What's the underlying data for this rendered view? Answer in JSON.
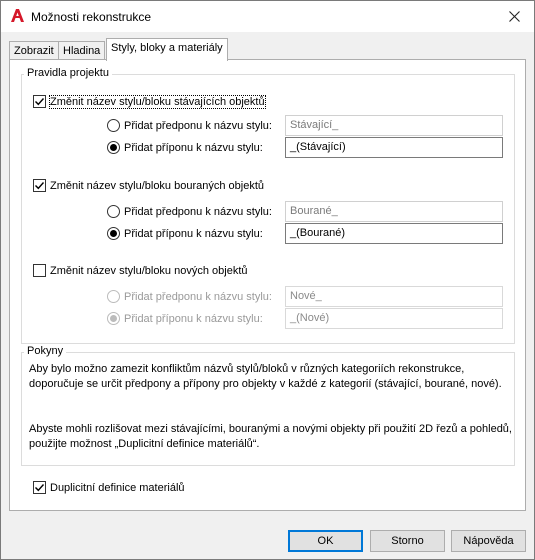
{
  "window": {
    "title": "Možnosti rekonstrukce",
    "icon": "autocad-a-icon",
    "accent_color": "#d5182a"
  },
  "tabs": [
    {
      "label": "Zobrazit",
      "active": false
    },
    {
      "label": "Hladina",
      "active": false
    },
    {
      "label": "Styly, bloky a materiály",
      "active": true
    }
  ],
  "project_rules": {
    "title": "Pravidla projektu",
    "existing": {
      "checkbox_label": "Změnit název stylu/bloku stávajících objektů",
      "checked": true,
      "prefix_label": "Přidat předponu k názvu stylu:",
      "prefix_value": "Stávající_",
      "suffix_label": "Přidat příponu k názvu stylu:",
      "suffix_value": "_(Stávající)",
      "selected": "suffix"
    },
    "demolished": {
      "checkbox_label": "Změnit název stylu/bloku bouraných objektů",
      "checked": true,
      "prefix_label": "Přidat předponu k názvu stylu:",
      "prefix_value": "Bourané_",
      "suffix_label": "Přidat příponu k názvu stylu:",
      "suffix_value": "_(Bourané)",
      "selected": "suffix"
    },
    "new": {
      "checkbox_label": "Změnit název stylu/bloku nových objektů",
      "checked": false,
      "prefix_label": "Přidat předponu k názvu stylu:",
      "prefix_value": "Nové_",
      "suffix_label": "Přidat příponu k názvu stylu:",
      "suffix_value": "_(Nové)",
      "selected": "suffix"
    }
  },
  "notes": {
    "title": "Pokyny",
    "paragraph1_line1": "Aby bylo možno zamezit konfliktům názvů stylů/bloků v různých kategoriích rekonstrukce,",
    "paragraph1_line2": "doporučuje se určit předpony a přípony pro objekty v každé z kategorií (stávající, bourané, nové).",
    "paragraph2_line1": "Abyste mohli rozlišovat mezi stávajícími, bouranými a novými objekty při použití 2D řezů a pohledů,",
    "paragraph2_line2": "použijte možnost „Duplicitní definice materiálů“."
  },
  "duplicate_materials": {
    "label": "Duplicitní definice materiálů",
    "checked": true
  },
  "buttons": {
    "ok": "OK",
    "cancel": "Storno",
    "help": "Nápověda"
  }
}
